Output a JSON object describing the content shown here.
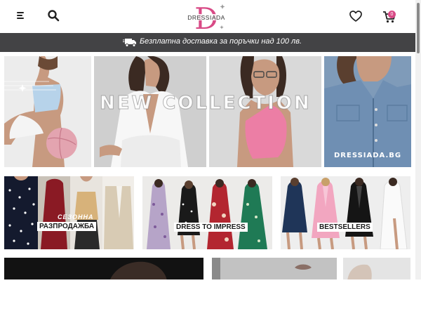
{
  "header": {
    "menu_icon": "hamburger-menu-icon",
    "search_icon": "search-icon",
    "logo_letter": "D",
    "logo_text": "DRESSIADA",
    "wishlist_icon": "heart-icon",
    "cart_icon": "cart-icon",
    "cart_count": "0"
  },
  "shipping_bar": {
    "icon": "delivery-truck-icon",
    "text": "Безплатна доставка за поръчки над 100 лв."
  },
  "hero": {
    "title": "NEW COLLECTION",
    "site": "DRESSIADA.BG"
  },
  "promos": [
    {
      "subtitle": "СЕЗОННА",
      "label": "РАЗПРОДАЖБА"
    },
    {
      "label": "DRESS TO IMPRESS"
    },
    {
      "label": "BESTSELLERS"
    }
  ],
  "colors": {
    "brand": "#d84a86",
    "shipping_bar_bg": "#434345",
    "text_dark": "#222222"
  }
}
